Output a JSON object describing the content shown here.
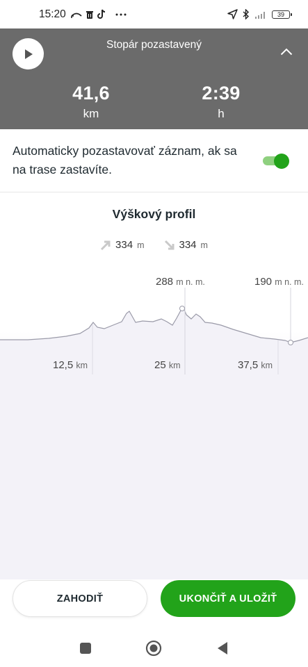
{
  "status_bar": {
    "time": "15:20",
    "icons": [
      "missed-call-icon",
      "trash-icon",
      "tiktok-icon",
      "more-dots-icon",
      "location-arrow-icon",
      "bluetooth-icon",
      "signal-icon"
    ],
    "battery": "39"
  },
  "header": {
    "title": "Stopár pozastavený",
    "distance": {
      "value": "41,6",
      "unit": "km"
    },
    "duration": {
      "value": "2:39",
      "unit": "h"
    },
    "background_color": "#6b6b6b"
  },
  "auto_pause": {
    "label": "Automaticky pozastavovať záznam, ak sa na trase zastavíte.",
    "enabled": true,
    "accent_color": "#22a31a"
  },
  "elevation_profile": {
    "title": "Výškový profil",
    "ascent": {
      "value": "334",
      "unit": "m"
    },
    "descent": {
      "value": "334",
      "unit": "m"
    },
    "max_marker": {
      "value": "288",
      "unit": "m n. m."
    },
    "end_marker": {
      "value": "190",
      "unit": "m n. m."
    },
    "distance_ticks": [
      {
        "value": "12,5",
        "unit": "km"
      },
      {
        "value": "25",
        "unit": "km"
      },
      {
        "value": "37,5",
        "unit": "km"
      }
    ]
  },
  "actions": {
    "discard_label": "ZAHODIŤ",
    "save_label": "UKONČIŤ A ULOŽIŤ"
  },
  "nav_bar": {
    "icons": [
      "recent-apps-icon",
      "home-icon",
      "back-icon"
    ]
  }
}
